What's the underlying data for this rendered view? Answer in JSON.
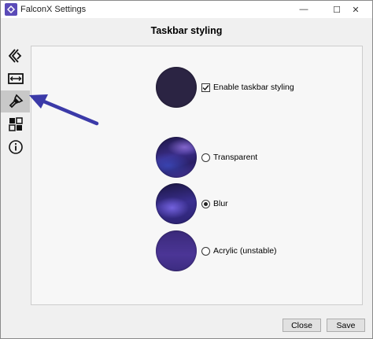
{
  "window": {
    "title": "FalconX Settings",
    "minimize_symbol": "—",
    "maximize_symbol": "☐",
    "close_symbol": "✕"
  },
  "page": {
    "title": "Taskbar styling"
  },
  "sidebar": {
    "items": [
      {
        "icon": "falconx-logo-icon",
        "active": false
      },
      {
        "icon": "position-width-icon",
        "active": false
      },
      {
        "icon": "paint-brush-icon",
        "active": true
      },
      {
        "icon": "grid-settings-icon",
        "active": false
      },
      {
        "icon": "info-icon",
        "active": false
      }
    ]
  },
  "styling": {
    "enable": {
      "label": "Enable taskbar styling",
      "checked": true
    },
    "options": [
      {
        "label": "Transparent",
        "selected": false
      },
      {
        "label": "Blur",
        "selected": true
      },
      {
        "label": "Acrylic (unstable)",
        "selected": false
      }
    ]
  },
  "footer": {
    "close_label": "Close",
    "save_label": "Save"
  },
  "colors": {
    "accent_arrow": "#3b3aa8",
    "preview_dark": "#2b2443",
    "active_nav": "#c8c8c8"
  }
}
